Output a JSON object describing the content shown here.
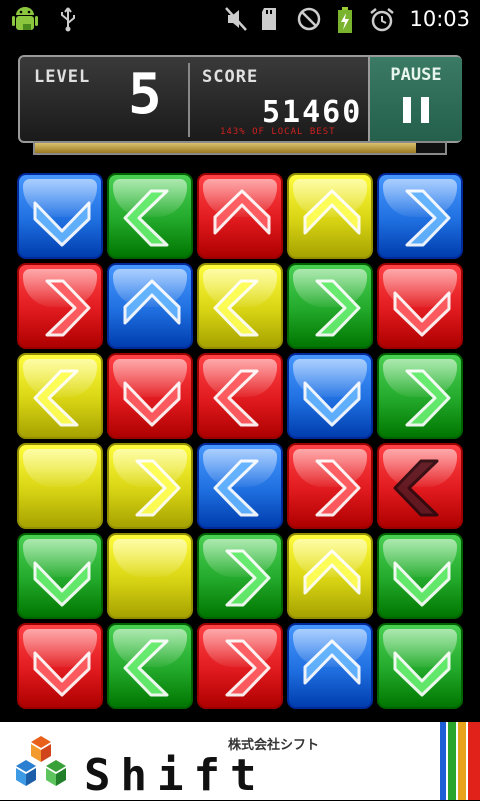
{
  "status_bar": {
    "time": "10:03",
    "icons": [
      "android-icon",
      "usb-icon",
      "muted-icon",
      "sdcard-icon",
      "no-signal-icon",
      "battery-charging-icon",
      "alarm-icon"
    ]
  },
  "header": {
    "level_label": "LEVEL",
    "level_value": "5",
    "score_label": "SCORE",
    "score_value": "51460",
    "score_note": "143% OF LOCAL BEST",
    "pause_label": "PAUSE",
    "progress_fraction": 0.93
  },
  "board": {
    "colors": {
      "blue": "#1f6fe0",
      "green": "#22a82a",
      "red": "#e01a1e",
      "yellow": "#d8d414"
    },
    "rows": [
      [
        {
          "color": "blue",
          "dir": "down"
        },
        {
          "color": "green",
          "dir": "left"
        },
        {
          "color": "red",
          "dir": "up"
        },
        {
          "color": "yellow",
          "dir": "up"
        },
        {
          "color": "blue",
          "dir": "right"
        }
      ],
      [
        {
          "color": "red",
          "dir": "right"
        },
        {
          "color": "blue",
          "dir": "up"
        },
        {
          "color": "yellow",
          "dir": "left"
        },
        {
          "color": "green",
          "dir": "right"
        },
        {
          "color": "red",
          "dir": "down"
        }
      ],
      [
        {
          "color": "yellow",
          "dir": "left"
        },
        {
          "color": "red",
          "dir": "down"
        },
        {
          "color": "red",
          "dir": "left"
        },
        {
          "color": "blue",
          "dir": "down"
        },
        {
          "color": "green",
          "dir": "right"
        }
      ],
      [
        {
          "color": "yellow",
          "dir": "none"
        },
        {
          "color": "yellow",
          "dir": "right"
        },
        {
          "color": "blue",
          "dir": "left"
        },
        {
          "color": "red",
          "dir": "right"
        },
        {
          "color": "red",
          "dir": "left-dark"
        }
      ],
      [
        {
          "color": "green",
          "dir": "down"
        },
        {
          "color": "yellow",
          "dir": "none"
        },
        {
          "color": "green",
          "dir": "right"
        },
        {
          "color": "yellow",
          "dir": "up"
        },
        {
          "color": "green",
          "dir": "down"
        }
      ],
      [
        {
          "color": "red",
          "dir": "down"
        },
        {
          "color": "green",
          "dir": "left"
        },
        {
          "color": "red",
          "dir": "right"
        },
        {
          "color": "blue",
          "dir": "up"
        },
        {
          "color": "green",
          "dir": "down"
        }
      ]
    ]
  },
  "ad": {
    "company": "株式会社シフト",
    "brand": "Shift"
  }
}
